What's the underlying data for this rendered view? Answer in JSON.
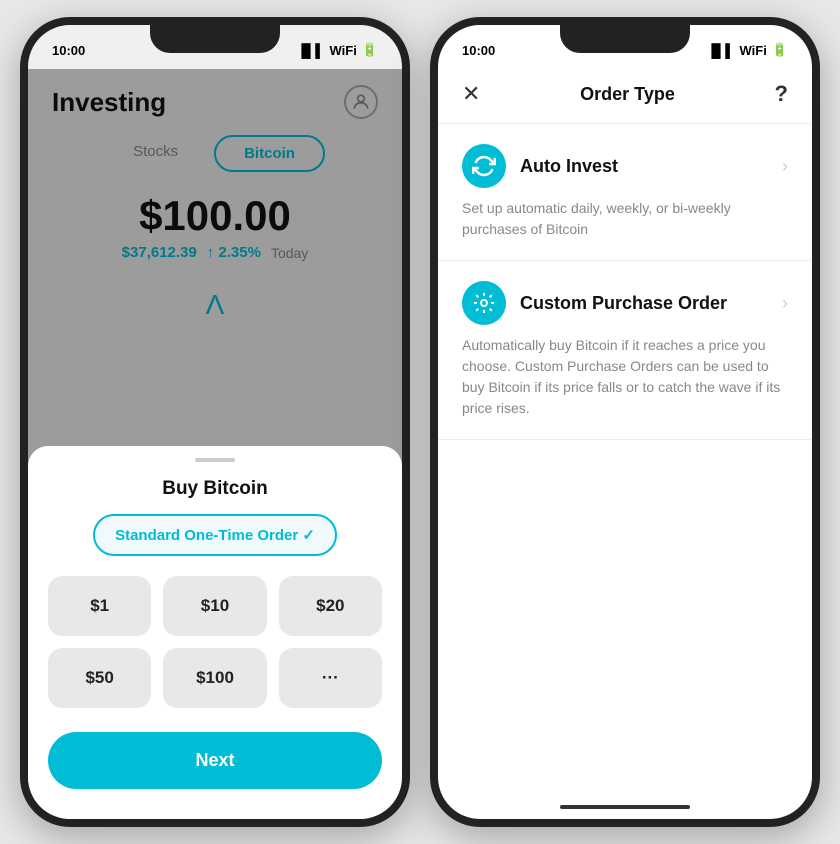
{
  "left_phone": {
    "status_time": "10:00",
    "header": {
      "title": "Investing",
      "avatar_label": "user-avatar"
    },
    "tabs": [
      {
        "label": "Stocks",
        "active": false
      },
      {
        "label": "Bitcoin",
        "active": true
      }
    ],
    "price": {
      "main": "$100.00",
      "usd": "$37,612.39",
      "pct": "↑ 2.35%",
      "period": "Today"
    },
    "bottom_sheet": {
      "title": "Buy Bitcoin",
      "order_type": "Standard One-Time Order ✓",
      "amounts": [
        "$1",
        "$10",
        "$20",
        "$50",
        "$100",
        "···"
      ],
      "next_button": "Next"
    }
  },
  "right_phone": {
    "status_time": "10:00",
    "header": {
      "title": "Order Type",
      "close_label": "✕",
      "help_label": "?"
    },
    "options": [
      {
        "name": "Auto Invest",
        "icon": "↻",
        "description": "Set up automatic daily, weekly, or bi-weekly purchases of Bitcoin"
      },
      {
        "name": "Custom Purchase Order",
        "icon": "⌖",
        "description": "Automatically buy Bitcoin if it reaches a price you choose. Custom Purchase Orders can be used to buy Bitcoin if its price falls or to catch the wave if its price rises."
      }
    ]
  }
}
